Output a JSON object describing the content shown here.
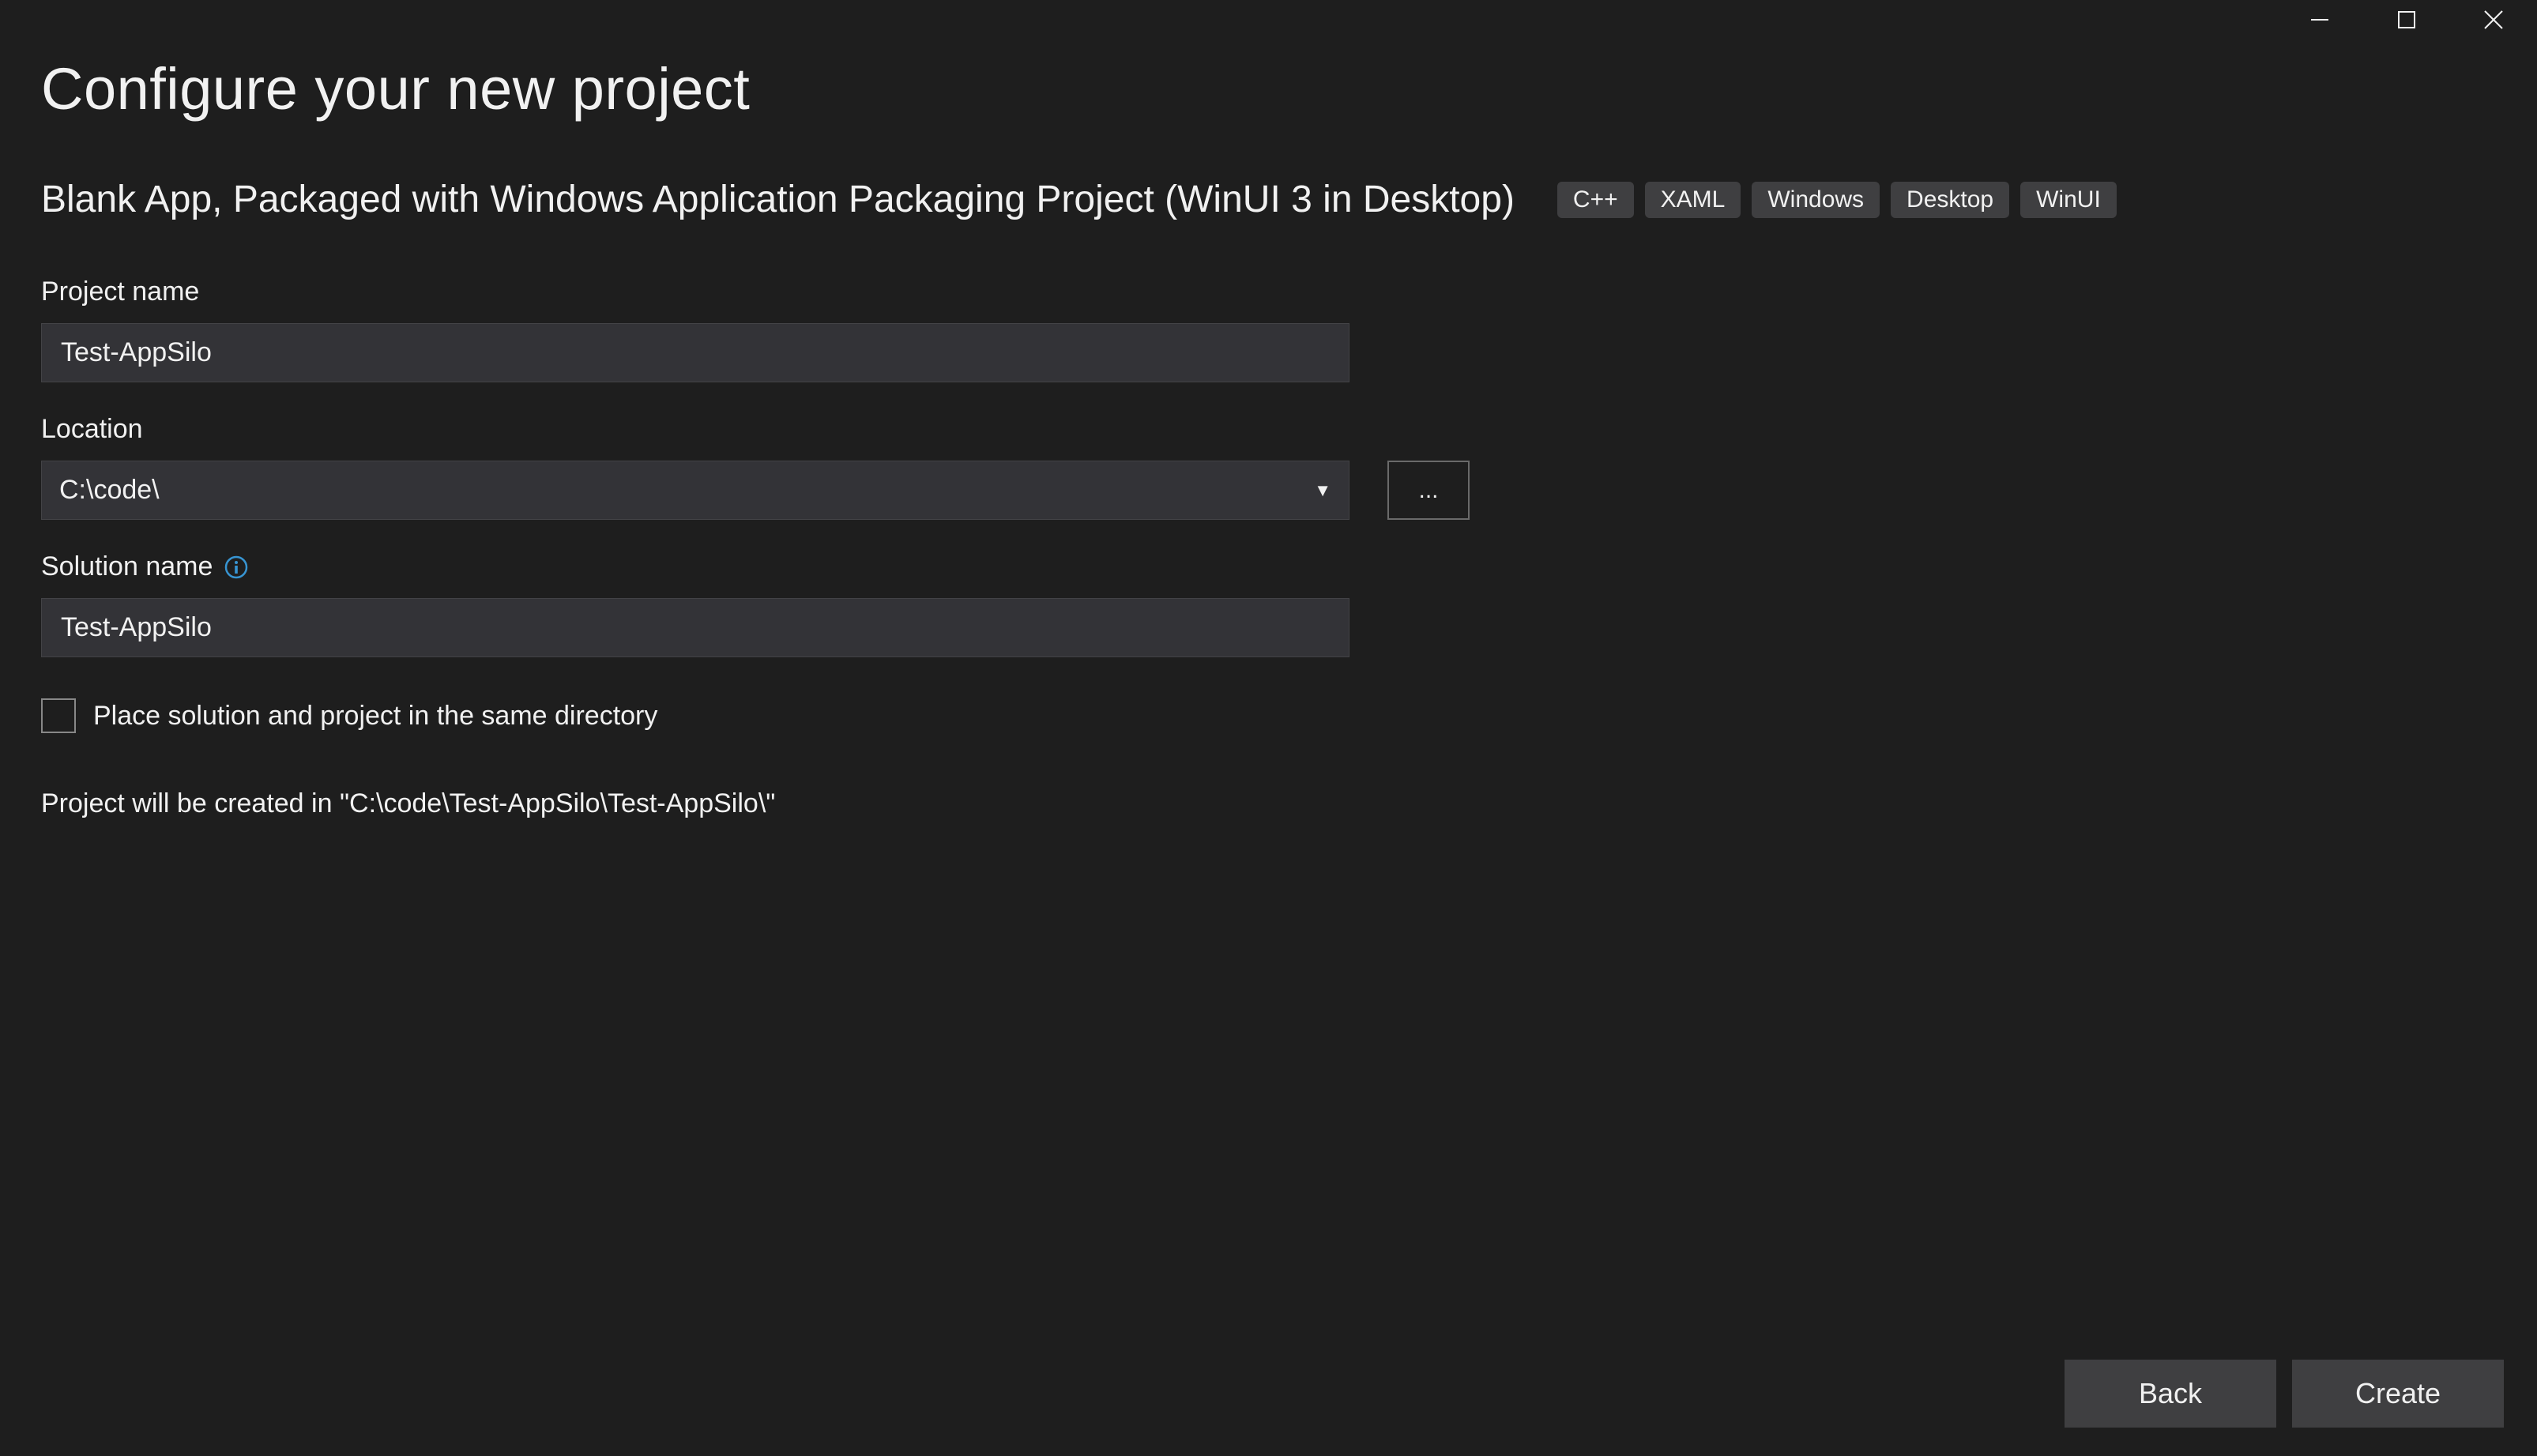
{
  "page": {
    "title": "Configure your new project",
    "template_name": "Blank App, Packaged with Windows Application Packaging Project (WinUI 3 in Desktop)",
    "tags": [
      "C++",
      "XAML",
      "Windows",
      "Desktop",
      "WinUI"
    ]
  },
  "fields": {
    "project_name_label": "Project name",
    "project_name_value": "Test-AppSilo",
    "location_label": "Location",
    "location_value": "C:\\code\\",
    "browse_label": "...",
    "solution_name_label": "Solution name",
    "solution_name_value": "Test-AppSilo",
    "same_dir_label": "Place solution and project in the same directory",
    "same_dir_checked": false,
    "summary_text": "Project will be created in \"C:\\code\\Test-AppSilo\\Test-AppSilo\\\""
  },
  "footer": {
    "back_label": "Back",
    "create_label": "Create"
  }
}
